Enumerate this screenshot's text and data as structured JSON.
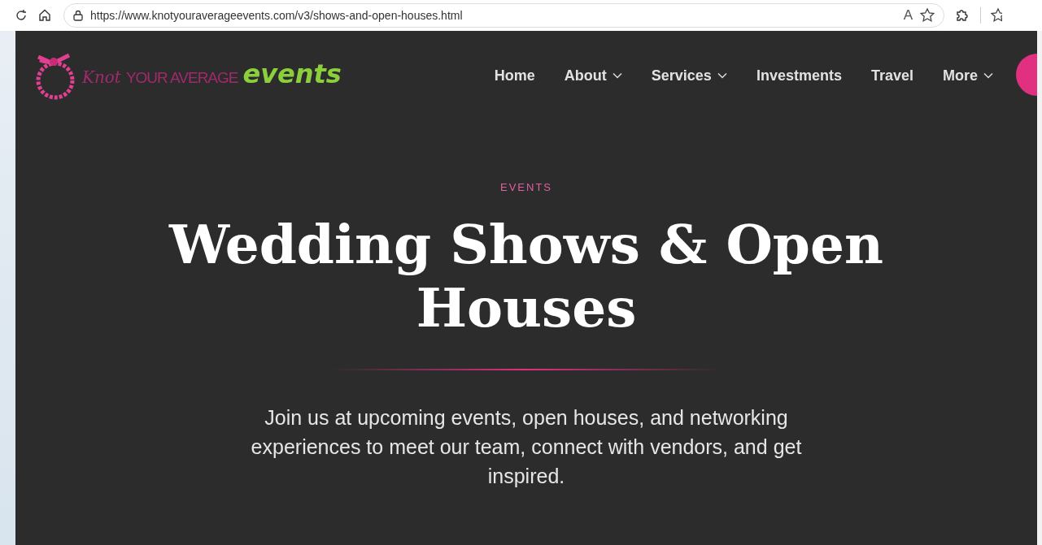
{
  "browser": {
    "url": "https://www.knotyouraverageevents.com/v3/shows-and-open-houses.html",
    "read_aloud_glyph": "A"
  },
  "logo": {
    "parts": [
      {
        "text": "Knot",
        "kind": "script"
      },
      {
        "text": "YOUR AVERAGE",
        "kind": "caps"
      },
      {
        "text": "events",
        "kind": "bold"
      }
    ]
  },
  "nav": [
    {
      "label": "Home",
      "dropdown": false
    },
    {
      "label": "About",
      "dropdown": true
    },
    {
      "label": "Services",
      "dropdown": true
    },
    {
      "label": "Investments",
      "dropdown": false
    },
    {
      "label": "Travel",
      "dropdown": false
    },
    {
      "label": "More",
      "dropdown": true
    }
  ],
  "hero": {
    "eyebrow": "EVENTS",
    "title": "Wedding Shows & Open Houses",
    "intro": "Join us at upcoming events, open houses, and networking experiences to meet our team, connect with vendors, and get inspired."
  }
}
